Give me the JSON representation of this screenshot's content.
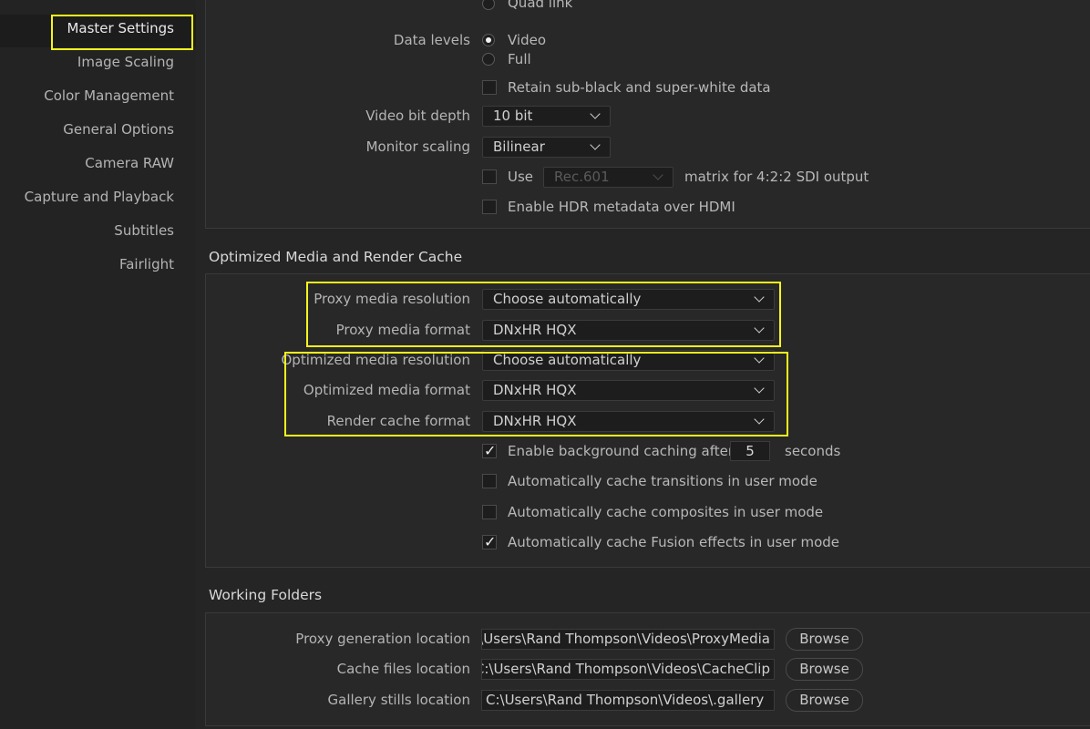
{
  "sidebar": {
    "items": [
      {
        "label": "Master Settings"
      },
      {
        "label": "Image Scaling"
      },
      {
        "label": "Color Management"
      },
      {
        "label": "General Options"
      },
      {
        "label": "Camera RAW"
      },
      {
        "label": "Capture and Playback"
      },
      {
        "label": "Subtitles"
      },
      {
        "label": "Fairlight"
      }
    ],
    "active_index": 0
  },
  "video_monitoring": {
    "quad_link_label": "Quad link",
    "data_levels_label": "Data levels",
    "data_levels_options": [
      {
        "label": "Video",
        "selected": true
      },
      {
        "label": "Full",
        "selected": false
      }
    ],
    "retain_label": "Retain sub-black and super-white data",
    "retain_checked": false,
    "bit_depth_label": "Video bit depth",
    "bit_depth_value": "10 bit",
    "monitor_scaling_label": "Monitor scaling",
    "monitor_scaling_value": "Bilinear",
    "use_label": "Use",
    "use_checked": false,
    "matrix_value": "Rec.601",
    "matrix_suffix": "matrix for 4:2:2 SDI output",
    "hdr_label": "Enable HDR metadata over HDMI",
    "hdr_checked": false
  },
  "optimized": {
    "title": "Optimized Media and Render Cache",
    "proxy_res_label": "Proxy media resolution",
    "proxy_res_value": "Choose automatically",
    "proxy_fmt_label": "Proxy media format",
    "proxy_fmt_value": "DNxHR HQX",
    "opt_res_label": "Optimized media resolution",
    "opt_res_value": "Choose automatically",
    "opt_fmt_label": "Optimized media format",
    "opt_fmt_value": "DNxHR HQX",
    "render_fmt_label": "Render cache format",
    "render_fmt_value": "DNxHR HQX",
    "bg_cache_label": "Enable background caching after",
    "bg_cache_checked": true,
    "bg_cache_seconds": "5",
    "bg_cache_unit": "seconds",
    "auto_transitions_label": "Automatically cache transitions in user mode",
    "auto_transitions_checked": false,
    "auto_composites_label": "Automatically cache composites in user mode",
    "auto_composites_checked": false,
    "auto_fusion_label": "Automatically cache Fusion effects in user mode",
    "auto_fusion_checked": true
  },
  "working_folders": {
    "title": "Working Folders",
    "rows": [
      {
        "label": "Proxy generation location",
        "path": "C:\\Users\\Rand Thompson\\Videos\\ProxyMedia",
        "button": "Browse"
      },
      {
        "label": "Cache files location",
        "path": "C:\\Users\\Rand Thompson\\Videos\\CacheClip",
        "button": "Browse"
      },
      {
        "label": "Gallery stills location",
        "path": "C:\\Users\\Rand Thompson\\Videos\\.gallery",
        "button": "Browse"
      }
    ]
  },
  "colors": {
    "highlight": "#f5f51e",
    "background": "#252525"
  }
}
